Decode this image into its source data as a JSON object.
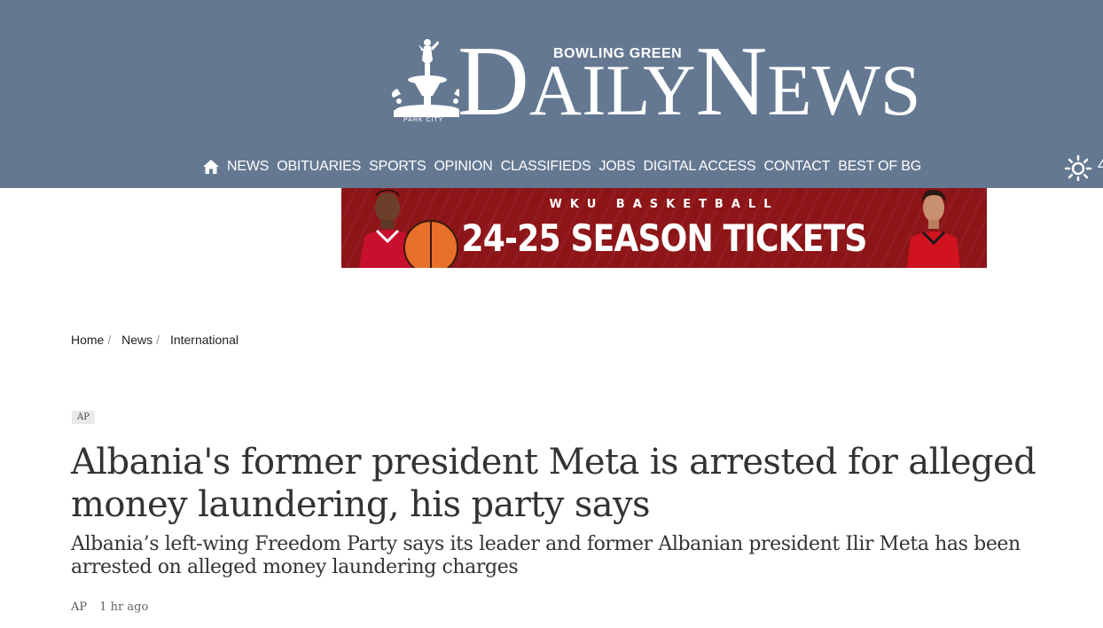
{
  "header": {
    "logo": {
      "brand_top": "BOWLING GREEN",
      "daily_first": "D",
      "daily_rest": "AILY",
      "news_first": "N",
      "news_rest": "EWS",
      "park_city": "PARK CITY"
    },
    "background_color": "#647891",
    "nav": {
      "home_icon": "home-icon",
      "items": [
        "NEWS",
        "OBITUARIES",
        "SPORTS",
        "OPINION",
        "CLASSIFIEDS",
        "JOBS",
        "DIGITAL ACCESS",
        "CONTACT",
        "BEST OF BG"
      ]
    },
    "weather": {
      "icon": "sun-icon",
      "temp": "4"
    }
  },
  "ad": {
    "subtitle": "WKU BASKETBALL",
    "title": "24-25 SEASON TICKETS",
    "background_color": "#8d1417"
  },
  "breadcrumb": {
    "items": [
      "Home",
      "News",
      "International"
    ]
  },
  "article": {
    "tag": "AP",
    "headline": "Albania's former president Meta is arrested for alleged money laundering, his party says",
    "summary": "Albania’s left-wing Freedom Party says its leader and former Albanian president Ilir Meta has been arrested on alleged money laundering charges",
    "byline": {
      "author": "AP",
      "time": "1 hr ago"
    }
  }
}
